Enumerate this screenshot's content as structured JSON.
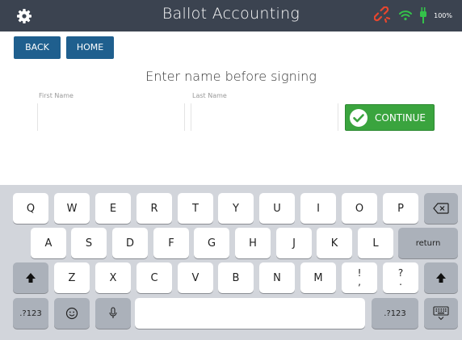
{
  "header": {
    "title": "Ballot Accounting",
    "battery": "100%"
  },
  "nav": {
    "back_label": "BACK",
    "home_label": "HOME"
  },
  "form": {
    "heading": "Enter name before signing",
    "first_name_label": "First Name",
    "first_name_value": "",
    "last_name_label": "Last Name",
    "last_name_value": "",
    "continue_label": "CONTINUE"
  },
  "keyboard": {
    "row1": [
      "Q",
      "W",
      "E",
      "R",
      "T",
      "Y",
      "U",
      "I",
      "O",
      "P"
    ],
    "row2": [
      "A",
      "S",
      "D",
      "F",
      "G",
      "H",
      "J",
      "K",
      "L"
    ],
    "return_label": "return",
    "row3": [
      "Z",
      "X",
      "C",
      "V",
      "B",
      "N",
      "M"
    ],
    "punct1_top": "!",
    "punct1_bottom": ",",
    "punct2_top": "?",
    "punct2_bottom": ".",
    "numbers_label_left": ".?123",
    "numbers_label_right": ".?123"
  },
  "colors": {
    "header_bg": "#3b4350",
    "nav_button_bg": "#1f5f8e",
    "continue_bg": "#3aa43e",
    "keyboard_bg": "#d2d5db",
    "disconnected_icon": "#e8462e",
    "wifi_icon": "#34c24a",
    "plug_icon": "#34c24a"
  }
}
